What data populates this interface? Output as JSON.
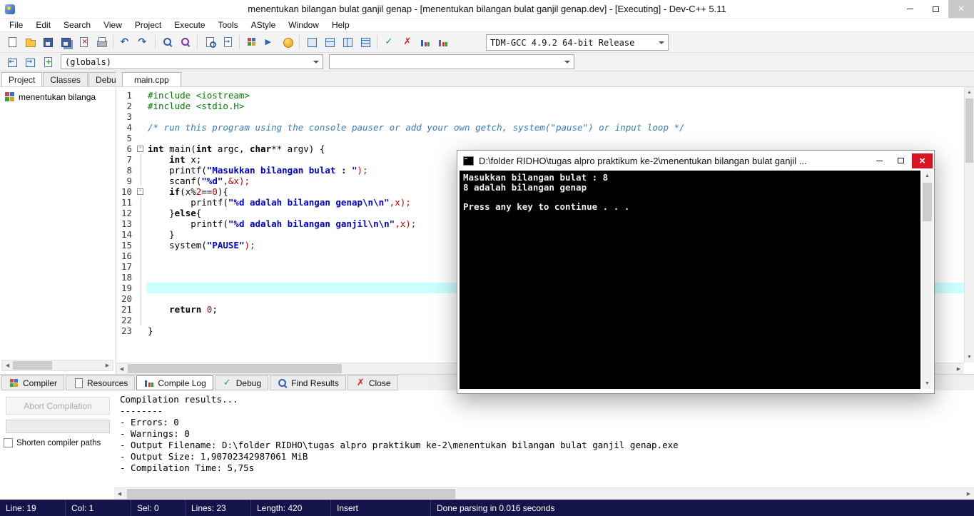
{
  "window": {
    "title": "menentukan bilangan bulat ganjil genap - [menentukan bilangan bulat ganjil genap.dev] - [Executing] - Dev-C++ 5.11"
  },
  "menu": {
    "items": [
      "File",
      "Edit",
      "Search",
      "View",
      "Project",
      "Execute",
      "Tools",
      "AStyle",
      "Window",
      "Help"
    ]
  },
  "toolbar_main": {
    "icons": [
      "new-file",
      "open",
      "save",
      "save-all",
      "close-file",
      "print",
      "|",
      "undo",
      "redo",
      "|",
      "find",
      "replace",
      "|",
      "find-next",
      "goto-line",
      "|",
      "compile",
      "run",
      "format",
      "|",
      "view-project",
      "view-compile",
      "view-debug",
      "view-report",
      "|",
      "syntax-check",
      "abort-compilation",
      "profile",
      "profiling-analysis"
    ],
    "compiler_combo": "TDM-GCC 4.9.2 64-bit Release"
  },
  "browser_bar": {
    "icons": [
      "goto-declaration",
      "goto-definition",
      "insert-snippet"
    ],
    "globals_combo": "(globals)",
    "members_combo": ""
  },
  "left_panel": {
    "tabs": [
      {
        "label": "Project",
        "active": true
      },
      {
        "label": "Classes",
        "active": false
      },
      {
        "label": "Debug",
        "active": false
      }
    ],
    "tree_items": [
      {
        "label": "menentukan bilanga"
      }
    ]
  },
  "editor": {
    "tabs": [
      {
        "label": "main.cpp",
        "active": true
      }
    ],
    "current_line": 19,
    "fold_lines": [
      6,
      10
    ],
    "lines": [
      [
        [
          "pre",
          "#include <iostream>"
        ]
      ],
      [
        [
          "pre",
          "#include <stdio.H>"
        ]
      ],
      [],
      [
        [
          "com",
          "/* run this program using the console pauser or add your own getch, system(\"pause\") or input loop */"
        ]
      ],
      [],
      [
        [
          "kw",
          "int"
        ],
        [
          "pl",
          " main("
        ],
        [
          "kw",
          "int"
        ],
        [
          "pl",
          " argc, "
        ],
        [
          "kw",
          "char"
        ],
        [
          "pl",
          "** argv) {"
        ]
      ],
      [
        [
          "pl",
          "    "
        ],
        [
          "kw",
          "int"
        ],
        [
          "pl",
          " x;"
        ]
      ],
      [
        [
          "pl",
          "    printf("
        ],
        [
          "str",
          "\"Masukkan bilangan bulat : \""
        ],
        [
          "red",
          ");"
        ]
      ],
      [
        [
          "pl",
          "    scanf("
        ],
        [
          "str",
          "\"%d\""
        ],
        [
          "red",
          ",&x);"
        ]
      ],
      [
        [
          "pl",
          "    "
        ],
        [
          "kw",
          "if"
        ],
        [
          "pl",
          "(x%"
        ],
        [
          "red",
          "2"
        ],
        [
          "pl",
          "=="
        ],
        [
          "red",
          "0"
        ],
        [
          "pl",
          "){"
        ]
      ],
      [
        [
          "pl",
          "        printf("
        ],
        [
          "str",
          "\"%d adalah bilangan genap\\n\\n\""
        ],
        [
          "red",
          ",x);"
        ]
      ],
      [
        [
          "pl",
          "    }"
        ],
        [
          "kw",
          "else"
        ],
        [
          "pl",
          "{"
        ]
      ],
      [
        [
          "pl",
          "        printf("
        ],
        [
          "str",
          "\"%d adalah bilangan ganjil\\n\\n\""
        ],
        [
          "red",
          ",x);"
        ]
      ],
      [
        [
          "pl",
          "    }"
        ]
      ],
      [
        [
          "pl",
          "    system("
        ],
        [
          "str",
          "\"PAUSE\""
        ],
        [
          "red",
          ");"
        ]
      ],
      [],
      [],
      [],
      [],
      [],
      [
        [
          "pl",
          "    "
        ],
        [
          "kw",
          "return"
        ],
        [
          "pl",
          " "
        ],
        [
          "red",
          "0"
        ],
        [
          "pl",
          ";"
        ]
      ],
      [],
      [
        [
          "pl",
          "}"
        ]
      ]
    ]
  },
  "console_window": {
    "title": "D:\\folder RIDHO\\tugas alpro praktikum ke-2\\menentukan bilangan bulat ganjil ...",
    "lines": [
      "Masukkan bilangan bulat : 8",
      "8 adalah bilangan genap",
      "",
      "Press any key to continue . . ."
    ]
  },
  "bottom_tabs": [
    {
      "label": "Compiler",
      "icon": "compiler",
      "active": false
    },
    {
      "label": "Resources",
      "icon": "resources",
      "active": false
    },
    {
      "label": "Compile Log",
      "icon": "compile-log",
      "active": true
    },
    {
      "label": "Debug",
      "icon": "debug",
      "active": false
    },
    {
      "label": "Find Results",
      "icon": "find-results",
      "active": false
    },
    {
      "label": "Close",
      "icon": "close",
      "active": false
    }
  ],
  "compile_log": {
    "abort_button": "Abort Compilation",
    "shorten_label": "Shorten compiler paths",
    "lines": [
      "Compilation results...",
      "--------",
      "- Errors: 0",
      "- Warnings: 0",
      "- Output Filename: D:\\folder RIDHO\\tugas alpro praktikum ke-2\\menentukan bilangan bulat ganjil genap.exe",
      "- Output Size: 1,90702342987061 MiB",
      "- Compilation Time: 5,75s"
    ]
  },
  "status_bar": {
    "segments": [
      "Line: 19",
      "Col: 1",
      "Sel: 0",
      "Lines: 23",
      "Length: 420",
      "Insert",
      "Done parsing in 0.016 seconds"
    ]
  },
  "colors": {
    "highlight_line": "#ccffff",
    "console_close": "#d81324",
    "status_bg": "#14144b",
    "string_token": "#0000d0",
    "preprocessor_token": "#007d00",
    "comment_token": "#3a7cb8"
  }
}
